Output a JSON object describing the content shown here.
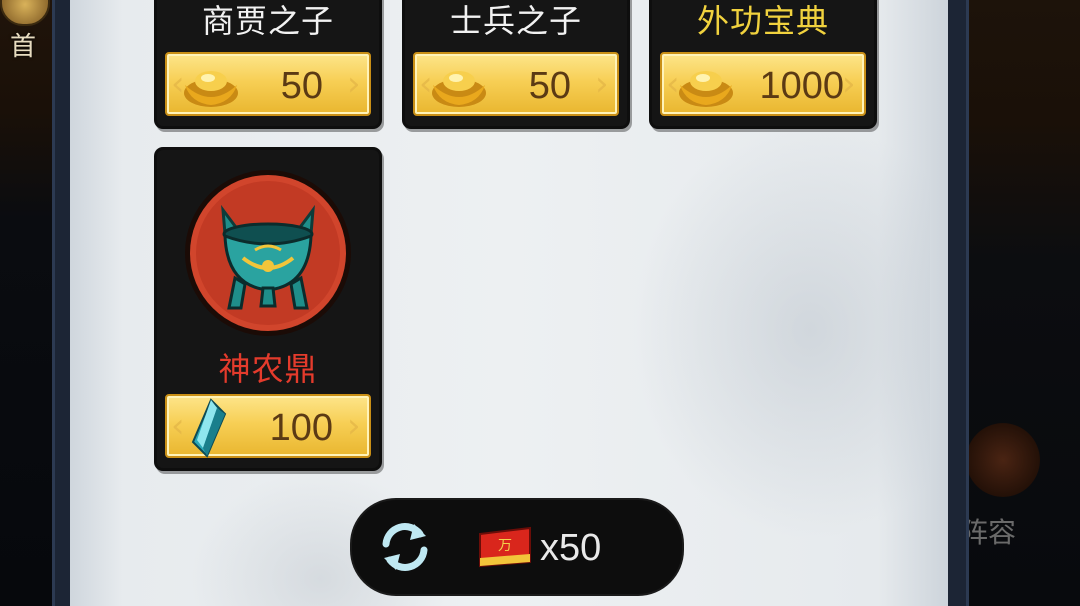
{
  "nav": {
    "home_label": "首",
    "lineup_label": "阵容"
  },
  "shop": {
    "items": [
      {
        "name": "商贾之子",
        "price": "50",
        "currency": "gold-ingot-icon",
        "name_color": "#f2f2f2"
      },
      {
        "name": "士兵之子",
        "price": "50",
        "currency": "gold-ingot-icon",
        "name_color": "#f2f2f2"
      },
      {
        "name": "外功宝典",
        "price": "1000",
        "currency": "gold-ingot-icon",
        "name_color": "#f1d23e"
      },
      {
        "name": "神农鼎",
        "price": "100",
        "currency": "crystal-icon",
        "name_color": "#e43b2c",
        "image": "cauldron-icon"
      }
    ]
  },
  "refresh": {
    "icon": "refresh-icon",
    "token_icon": "refresh-token-icon",
    "token_mark": "万",
    "token_count": "x50"
  },
  "colors": {
    "button_gold": "#f7cf55",
    "price_text": "#5b3a14",
    "rare_name": "#f1d23e",
    "epic_name": "#e43b2c"
  }
}
